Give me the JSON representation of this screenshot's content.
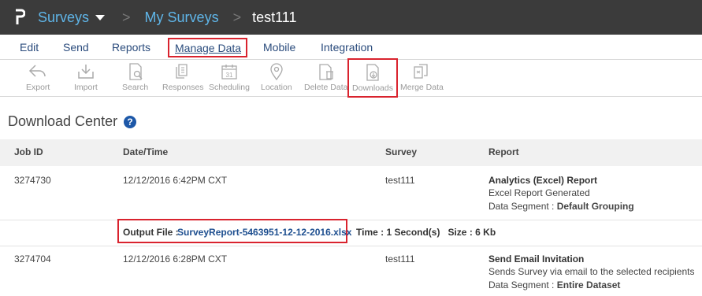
{
  "topbar": {
    "app_name": "Surveys",
    "separator": ">",
    "breadcrumb_link": "My Surveys",
    "current_survey": "test111"
  },
  "tabs": {
    "edit": "Edit",
    "send": "Send",
    "reports": "Reports",
    "manage_data": "Manage Data",
    "mobile": "Mobile",
    "integration": "Integration"
  },
  "toolbar": {
    "export": "Export",
    "import": "Import",
    "search": "Search",
    "responses": "Responses",
    "scheduling": "Scheduling",
    "location": "Location",
    "delete_data": "Delete Data",
    "downloads": "Downloads",
    "merge_data": "Merge Data"
  },
  "download_center": {
    "title": "Download Center",
    "help_glyph": "?"
  },
  "table": {
    "headers": {
      "job_id": "Job ID",
      "date_time": "Date/Time",
      "survey": "Survey",
      "report": "Report"
    },
    "rows": [
      {
        "job_id": "3274730",
        "date_time": "12/12/2016 6:42PM CXT",
        "survey": "test111",
        "report_title": "Analytics (Excel) Report",
        "report_line2": "Excel Report Generated",
        "segment_label": "Data Segment : ",
        "segment_value": "Default Grouping",
        "output_label": "Output File : ",
        "output_file": "SurveyReport-5463951-12-12-2016.xlsx",
        "time_size": "Time : 1 Second(s)   Size : 6 Kb"
      },
      {
        "job_id": "3274704",
        "date_time": "12/12/2016 6:28PM CXT",
        "survey": "test111",
        "report_title": "Send Email Invitation",
        "report_line2": "Sends Survey via email to the selected recipients",
        "segment_label": "Data Segment : ",
        "segment_value": "Entire Dataset"
      }
    ]
  },
  "colors": {
    "topbar_bg": "#3b3b3b",
    "link_blue": "#5fb5e8",
    "tab_blue": "#2a4b7c",
    "highlight_red": "#d9232e",
    "help_blue": "#1d58a8"
  }
}
